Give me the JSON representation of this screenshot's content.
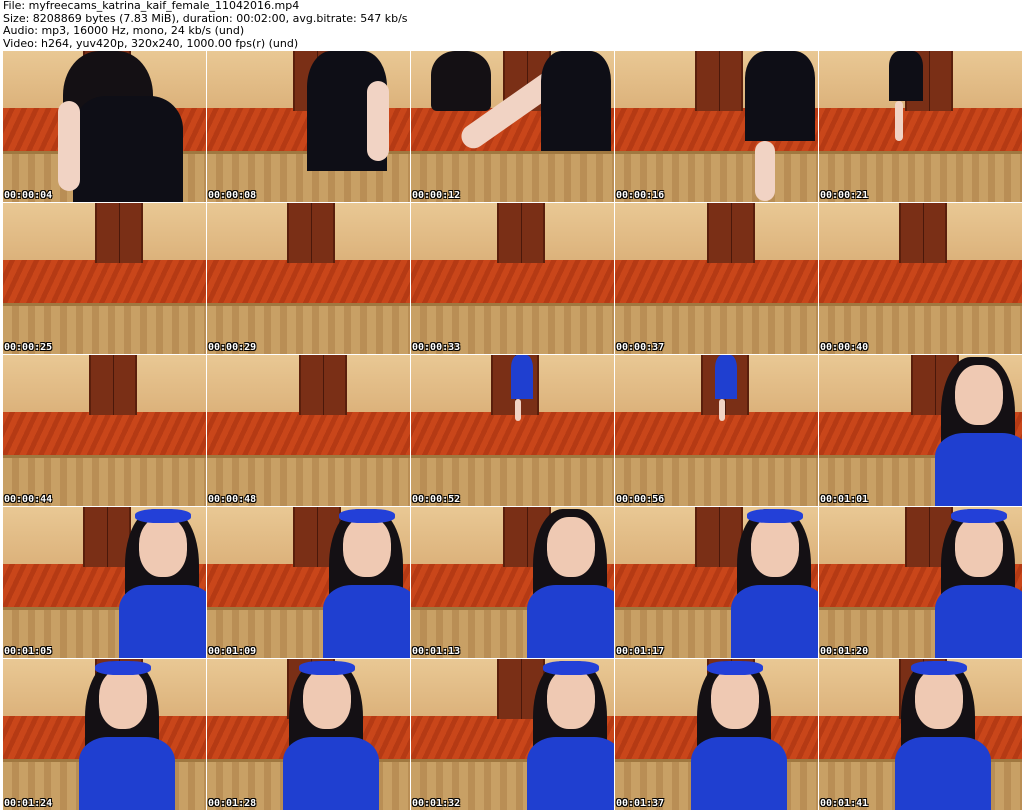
{
  "header": {
    "line1": "File: myfreecams_katrina_kaif_female_11042016.mp4",
    "line2": "Size: 8208869 bytes (7.83 MiB), duration: 00:02:00, avg.bitrate: 547 kb/s",
    "line3": "Audio: mp3, 16000 Hz, mono, 24 kb/s (und)",
    "line4": "Video: h264, yuv420p, 320x240, 1000.00 fps(r) (und)"
  },
  "thumbnails": [
    {
      "time": "00:00:04",
      "scene": "closeup-black"
    },
    {
      "time": "00:00:08",
      "scene": "walk-black"
    },
    {
      "time": "00:00:12",
      "scene": "arm-black"
    },
    {
      "time": "00:00:16",
      "scene": "legs-black"
    },
    {
      "time": "00:00:21",
      "scene": "far-black"
    },
    {
      "time": "00:00:25",
      "scene": "empty"
    },
    {
      "time": "00:00:29",
      "scene": "empty"
    },
    {
      "time": "00:00:33",
      "scene": "empty"
    },
    {
      "time": "00:00:37",
      "scene": "empty"
    },
    {
      "time": "00:00:40",
      "scene": "empty"
    },
    {
      "time": "00:00:44",
      "scene": "empty"
    },
    {
      "time": "00:00:48",
      "scene": "empty"
    },
    {
      "time": "00:00:52",
      "scene": "far-blue"
    },
    {
      "time": "00:00:56",
      "scene": "far-blue"
    },
    {
      "time": "00:01:01",
      "scene": "right-blue"
    },
    {
      "time": "00:01:05",
      "scene": "right-blue-band"
    },
    {
      "time": "00:01:09",
      "scene": "right-blue-band"
    },
    {
      "time": "00:01:13",
      "scene": "right-blue"
    },
    {
      "time": "00:01:17",
      "scene": "right-blue-band"
    },
    {
      "time": "00:01:20",
      "scene": "right-blue-band"
    },
    {
      "time": "00:01:24",
      "scene": "center-blue-band"
    },
    {
      "time": "00:01:28",
      "scene": "center-blue-band"
    },
    {
      "time": "00:01:32",
      "scene": "right-blue-band"
    },
    {
      "time": "00:01:37",
      "scene": "center-blue-band"
    },
    {
      "time": "00:01:41",
      "scene": "center-blue-band"
    }
  ],
  "colors": {
    "blue_dress": "#1f3fd0",
    "black_dress": "#0e0e16",
    "headband": "#2340d8"
  }
}
